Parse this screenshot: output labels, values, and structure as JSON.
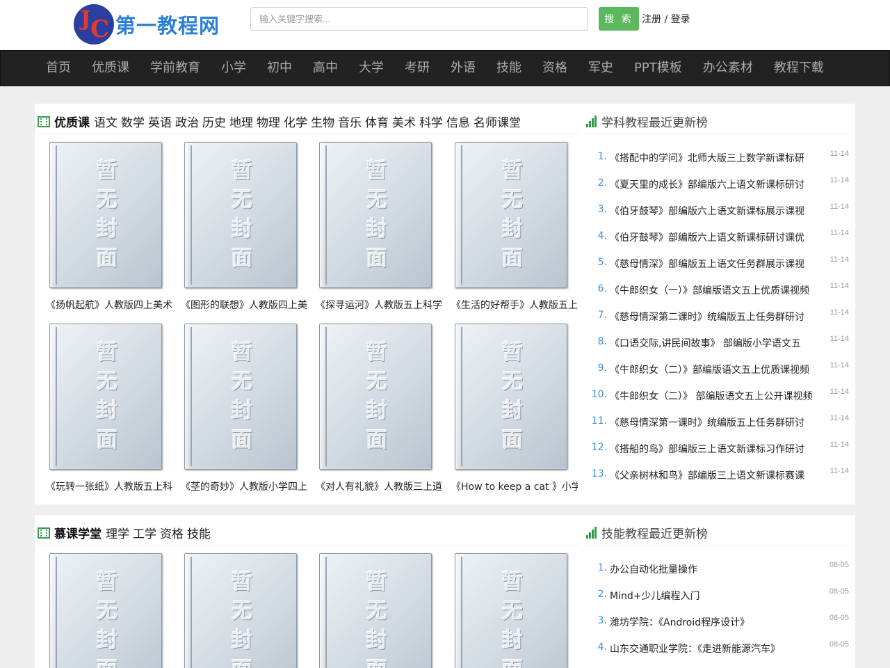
{
  "header": {
    "logo_mark_j": "J",
    "logo_mark_c": "C",
    "logo_text": "第一教程网",
    "search_placeholder": "输入关键字搜索...",
    "search_button": "搜 索",
    "register": "注册",
    "divider": "/",
    "login": "登录"
  },
  "nav": [
    "首页",
    "优质课",
    "学前教育",
    "小学",
    "初中",
    "高中",
    "大学",
    "考研",
    "外语",
    "技能",
    "资格",
    "军史",
    "PPT模板",
    "办公素材",
    "教程下载"
  ],
  "section1": {
    "title": "优质课",
    "links": [
      "语文",
      "数学",
      "英语",
      "政治",
      "历史",
      "地理",
      "物理",
      "化学",
      "生物",
      "音乐",
      "体育",
      "美术",
      "科学",
      "信息",
      "名师课堂"
    ],
    "cover_text": "暂无封面",
    "items": [
      "《扬帆起航》人教版四上美术",
      "《图形的联想》人教版四上美术",
      "《探寻运河》人教版五上科学",
      "《生活的好帮手》人教版五上",
      "《玩转一张纸》人教版五上科学",
      "《茎的奇妙》人教版小学四上",
      "《对人有礼貌》人教版三上道德",
      "《How to keep a cat 》小学"
    ]
  },
  "rank1": {
    "title": "学科教程最近更新榜",
    "items": [
      {
        "num": "1.",
        "text": "《搭配中的学问》北师大版三上数学新课标研",
        "date": "11-14"
      },
      {
        "num": "2.",
        "text": "《夏天里的成长》部编版六上语文新课标研讨",
        "date": "11-14"
      },
      {
        "num": "3.",
        "text": "《伯牙鼓琴》部编版六上语文新课标展示课视",
        "date": "11-14"
      },
      {
        "num": "4.",
        "text": "《伯牙鼓琴》部编版六上语文新课标研讨课优",
        "date": "11-14"
      },
      {
        "num": "5.",
        "text": "《慈母情深》部编版五上语文任务群展示课视",
        "date": "11-14"
      },
      {
        "num": "6.",
        "text": "《牛郎织女（一）》部编版语文五上优质课视频",
        "date": "11-14"
      },
      {
        "num": "7.",
        "text": "《慈母情深第二课时》统编版五上任务群研讨",
        "date": "11-14"
      },
      {
        "num": "8.",
        "text": "《口语交际,讲民间故事》 部编版小学语文五",
        "date": "11-14"
      },
      {
        "num": "9.",
        "text": "《牛郎织女（二）》部编版语文五上优质课视频",
        "date": "11-14"
      },
      {
        "num": "10.",
        "text": "《牛郎织女（二）》 部编版语文五上公开课视频",
        "date": "11-14"
      },
      {
        "num": "11.",
        "text": "《慈母情深第一课时》统编版五上任务群研讨",
        "date": "11-14"
      },
      {
        "num": "12.",
        "text": "《搭船的鸟》部编版三上语文新课标习作研讨",
        "date": "11-14"
      },
      {
        "num": "13.",
        "text": "《父亲树林和鸟》部编版三上语文新课标赛课",
        "date": "11-14"
      }
    ]
  },
  "section2": {
    "title": "慕课学堂",
    "links": [
      "理学",
      "工学",
      "资格",
      "技能"
    ]
  },
  "rank2": {
    "title": "技能教程最近更新榜",
    "items": [
      {
        "num": "1.",
        "text": "办公自动化批量操作",
        "date": "08-05"
      },
      {
        "num": "2.",
        "text": "Mind+少儿编程入门",
        "date": "08-05"
      },
      {
        "num": "3.",
        "text": "潍坊学院：《Android程序设计》",
        "date": "08-05"
      },
      {
        "num": "4.",
        "text": "山东交通职业学院：《走进新能源汽车》",
        "date": "08-05"
      }
    ]
  }
}
